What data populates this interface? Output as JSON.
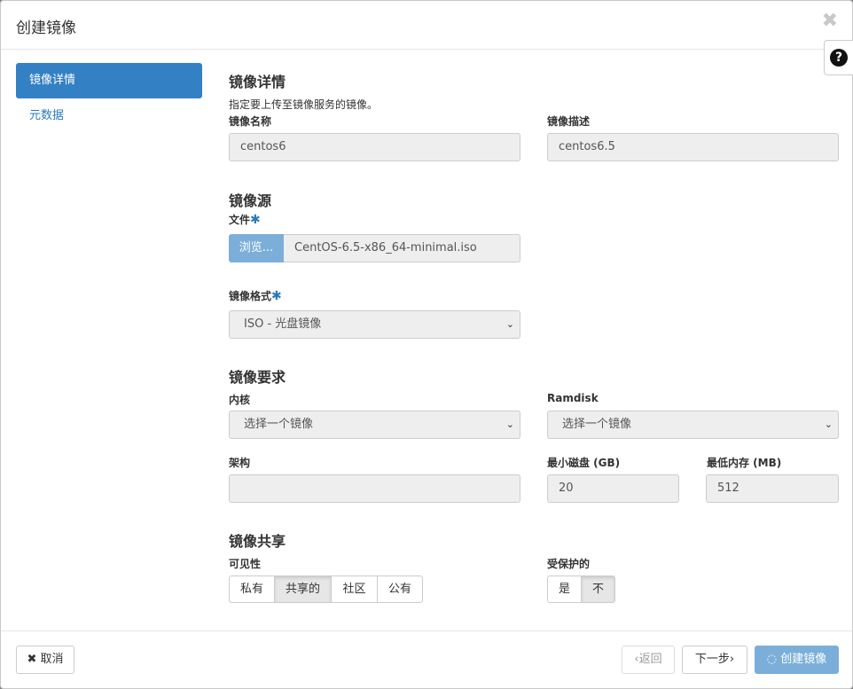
{
  "modal": {
    "title": "创建镜像"
  },
  "nav": {
    "items": [
      {
        "label": "镜像详情"
      },
      {
        "label": "元数据"
      }
    ]
  },
  "details": {
    "title": "镜像详情",
    "help": "指定要上传至镜像服务的镜像。",
    "name_label": "镜像名称",
    "name_value": "centos6",
    "desc_label": "镜像描述",
    "desc_value": "centos6.5"
  },
  "source": {
    "title": "镜像源",
    "file_label": "文件",
    "required_mark": "✱",
    "browse_label": "浏览...",
    "file_name": "CentOS-6.5-x86_64-minimal.iso",
    "format_label": "镜像格式",
    "format_value": "ISO - 光盘镜像"
  },
  "requirements": {
    "title": "镜像要求",
    "kernel_label": "内核",
    "kernel_value": "选择一个镜像",
    "ramdisk_label": "Ramdisk",
    "ramdisk_value": "选择一个镜像",
    "arch_label": "架构",
    "arch_value": "",
    "min_disk_label": "最小磁盘 (GB)",
    "min_disk_value": "20",
    "min_ram_label": "最低内存 (MB)",
    "min_ram_value": "512"
  },
  "sharing": {
    "title": "镜像共享",
    "visibility_label": "可见性",
    "visibility_options": [
      "私有",
      "共享的",
      "社区",
      "公有"
    ],
    "visibility_selected": "共享的",
    "protected_label": "受保护的",
    "protected_options": [
      "是",
      "不"
    ],
    "protected_selected": "不"
  },
  "footer": {
    "cancel_label": "取消",
    "back_label": "返回",
    "next_label": "下一步",
    "create_label": "创建镜像"
  }
}
